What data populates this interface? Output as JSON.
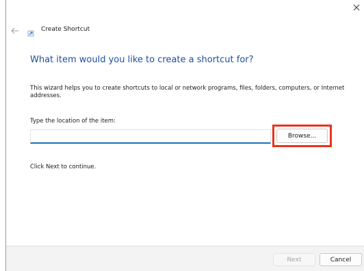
{
  "window": {
    "title": "Create Shortcut",
    "close_icon": "close-icon",
    "back_icon": "back-arrow-icon",
    "app_icon": "shortcut-icon"
  },
  "content": {
    "heading": "What item would you like to create a shortcut for?",
    "description": "This wizard helps you to create shortcuts to local or network programs, files, folders, computers, or Internet addresses.",
    "location_label": "Type the location of the item:",
    "location_value": "",
    "browse_label": "Browse...",
    "hint": "Click Next to continue."
  },
  "footer": {
    "next_label": "Next",
    "cancel_label": "Cancel"
  },
  "colors": {
    "heading": "#1f4e9c",
    "input_underline": "#1f6fb8",
    "highlight": "#e8331c",
    "footer_bg": "#f3f3f3"
  }
}
